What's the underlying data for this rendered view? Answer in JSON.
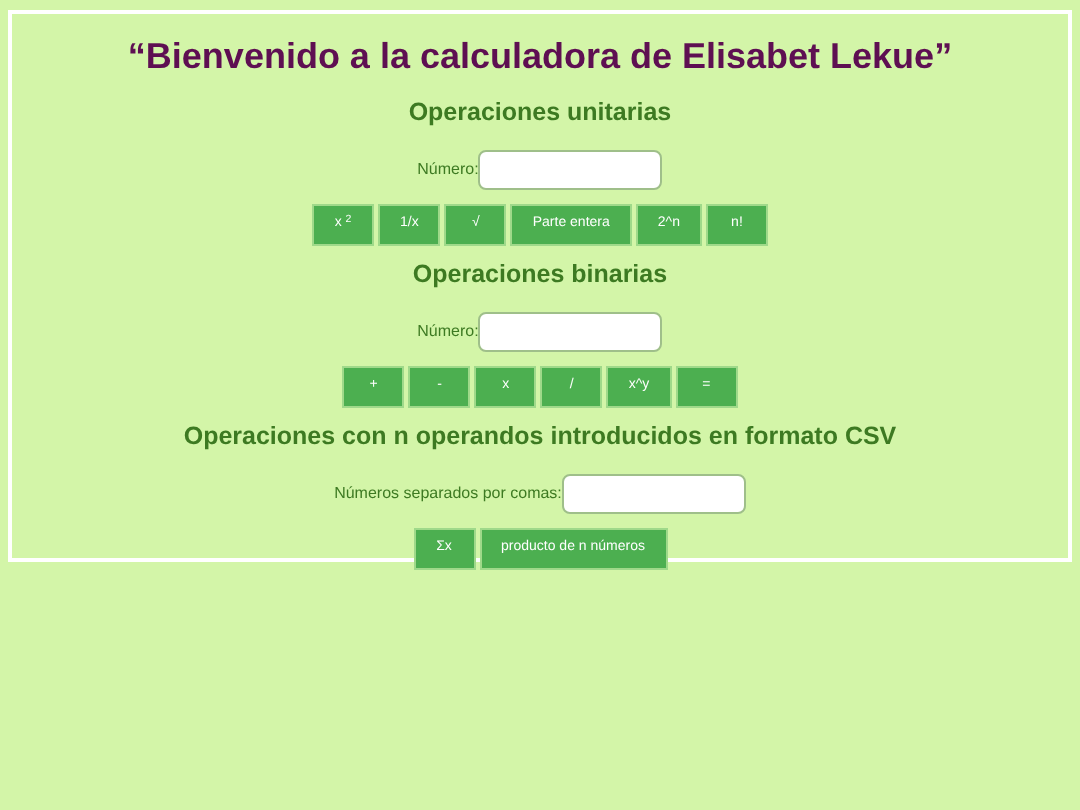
{
  "title": "“Bienvenido a la calculadora de Elisabet Lekue”",
  "sections": [
    {
      "heading": "Operaciones unitarias",
      "field_label": "Número:",
      "buttons": [
        "x $^{2}$",
        "1/x",
        "√",
        "Parte entera",
        "2^n",
        "n!"
      ]
    },
    {
      "heading": "Operaciones binarias",
      "field_label": "Número:",
      "buttons": [
        "+",
        "-",
        "x",
        "/",
        "x^y",
        "="
      ]
    },
    {
      "heading": "Operaciones con n operandos introducidos en formato CSV",
      "field_label": "Números separados por comas:",
      "buttons": [
        "Σx",
        "producto de n números"
      ]
    }
  ]
}
